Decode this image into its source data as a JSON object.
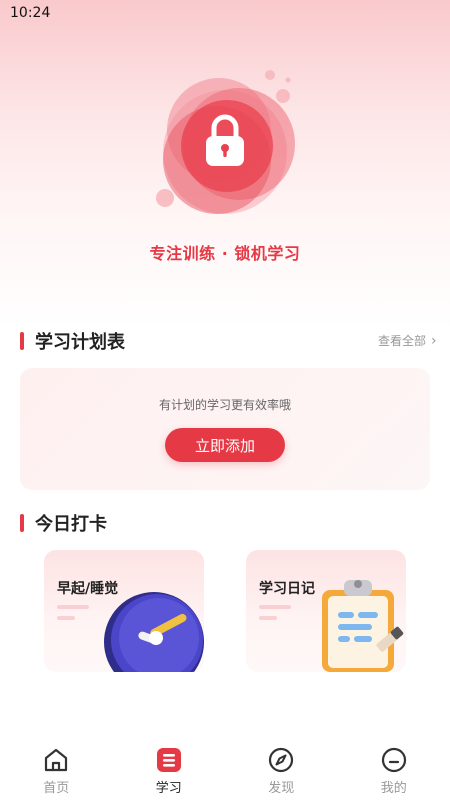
{
  "status_bar": {
    "time": "10:24"
  },
  "hero": {
    "slogan": "专注训练 · 锁机学习",
    "icon": "lock-icon"
  },
  "plan_section": {
    "title": "学习计划表",
    "view_all": "查看全部",
    "empty_hint": "有计划的学习更有效率哦",
    "add_button": "立即添加"
  },
  "checkin_section": {
    "title": "今日打卡",
    "cards": [
      {
        "title": "早起/睡觉",
        "icon": "clock-icon"
      },
      {
        "title": "学习日记",
        "icon": "clipboard-icon"
      }
    ]
  },
  "tabbar": {
    "items": [
      {
        "label": "首页",
        "icon": "home-icon",
        "active": false
      },
      {
        "label": "学习",
        "icon": "study-icon",
        "active": true
      },
      {
        "label": "发现",
        "icon": "compass-icon",
        "active": false
      },
      {
        "label": "我的",
        "icon": "profile-icon",
        "active": false
      }
    ]
  },
  "colors": {
    "accent": "#e63946",
    "card_bg": "#fff0f0",
    "muted": "#999999"
  }
}
